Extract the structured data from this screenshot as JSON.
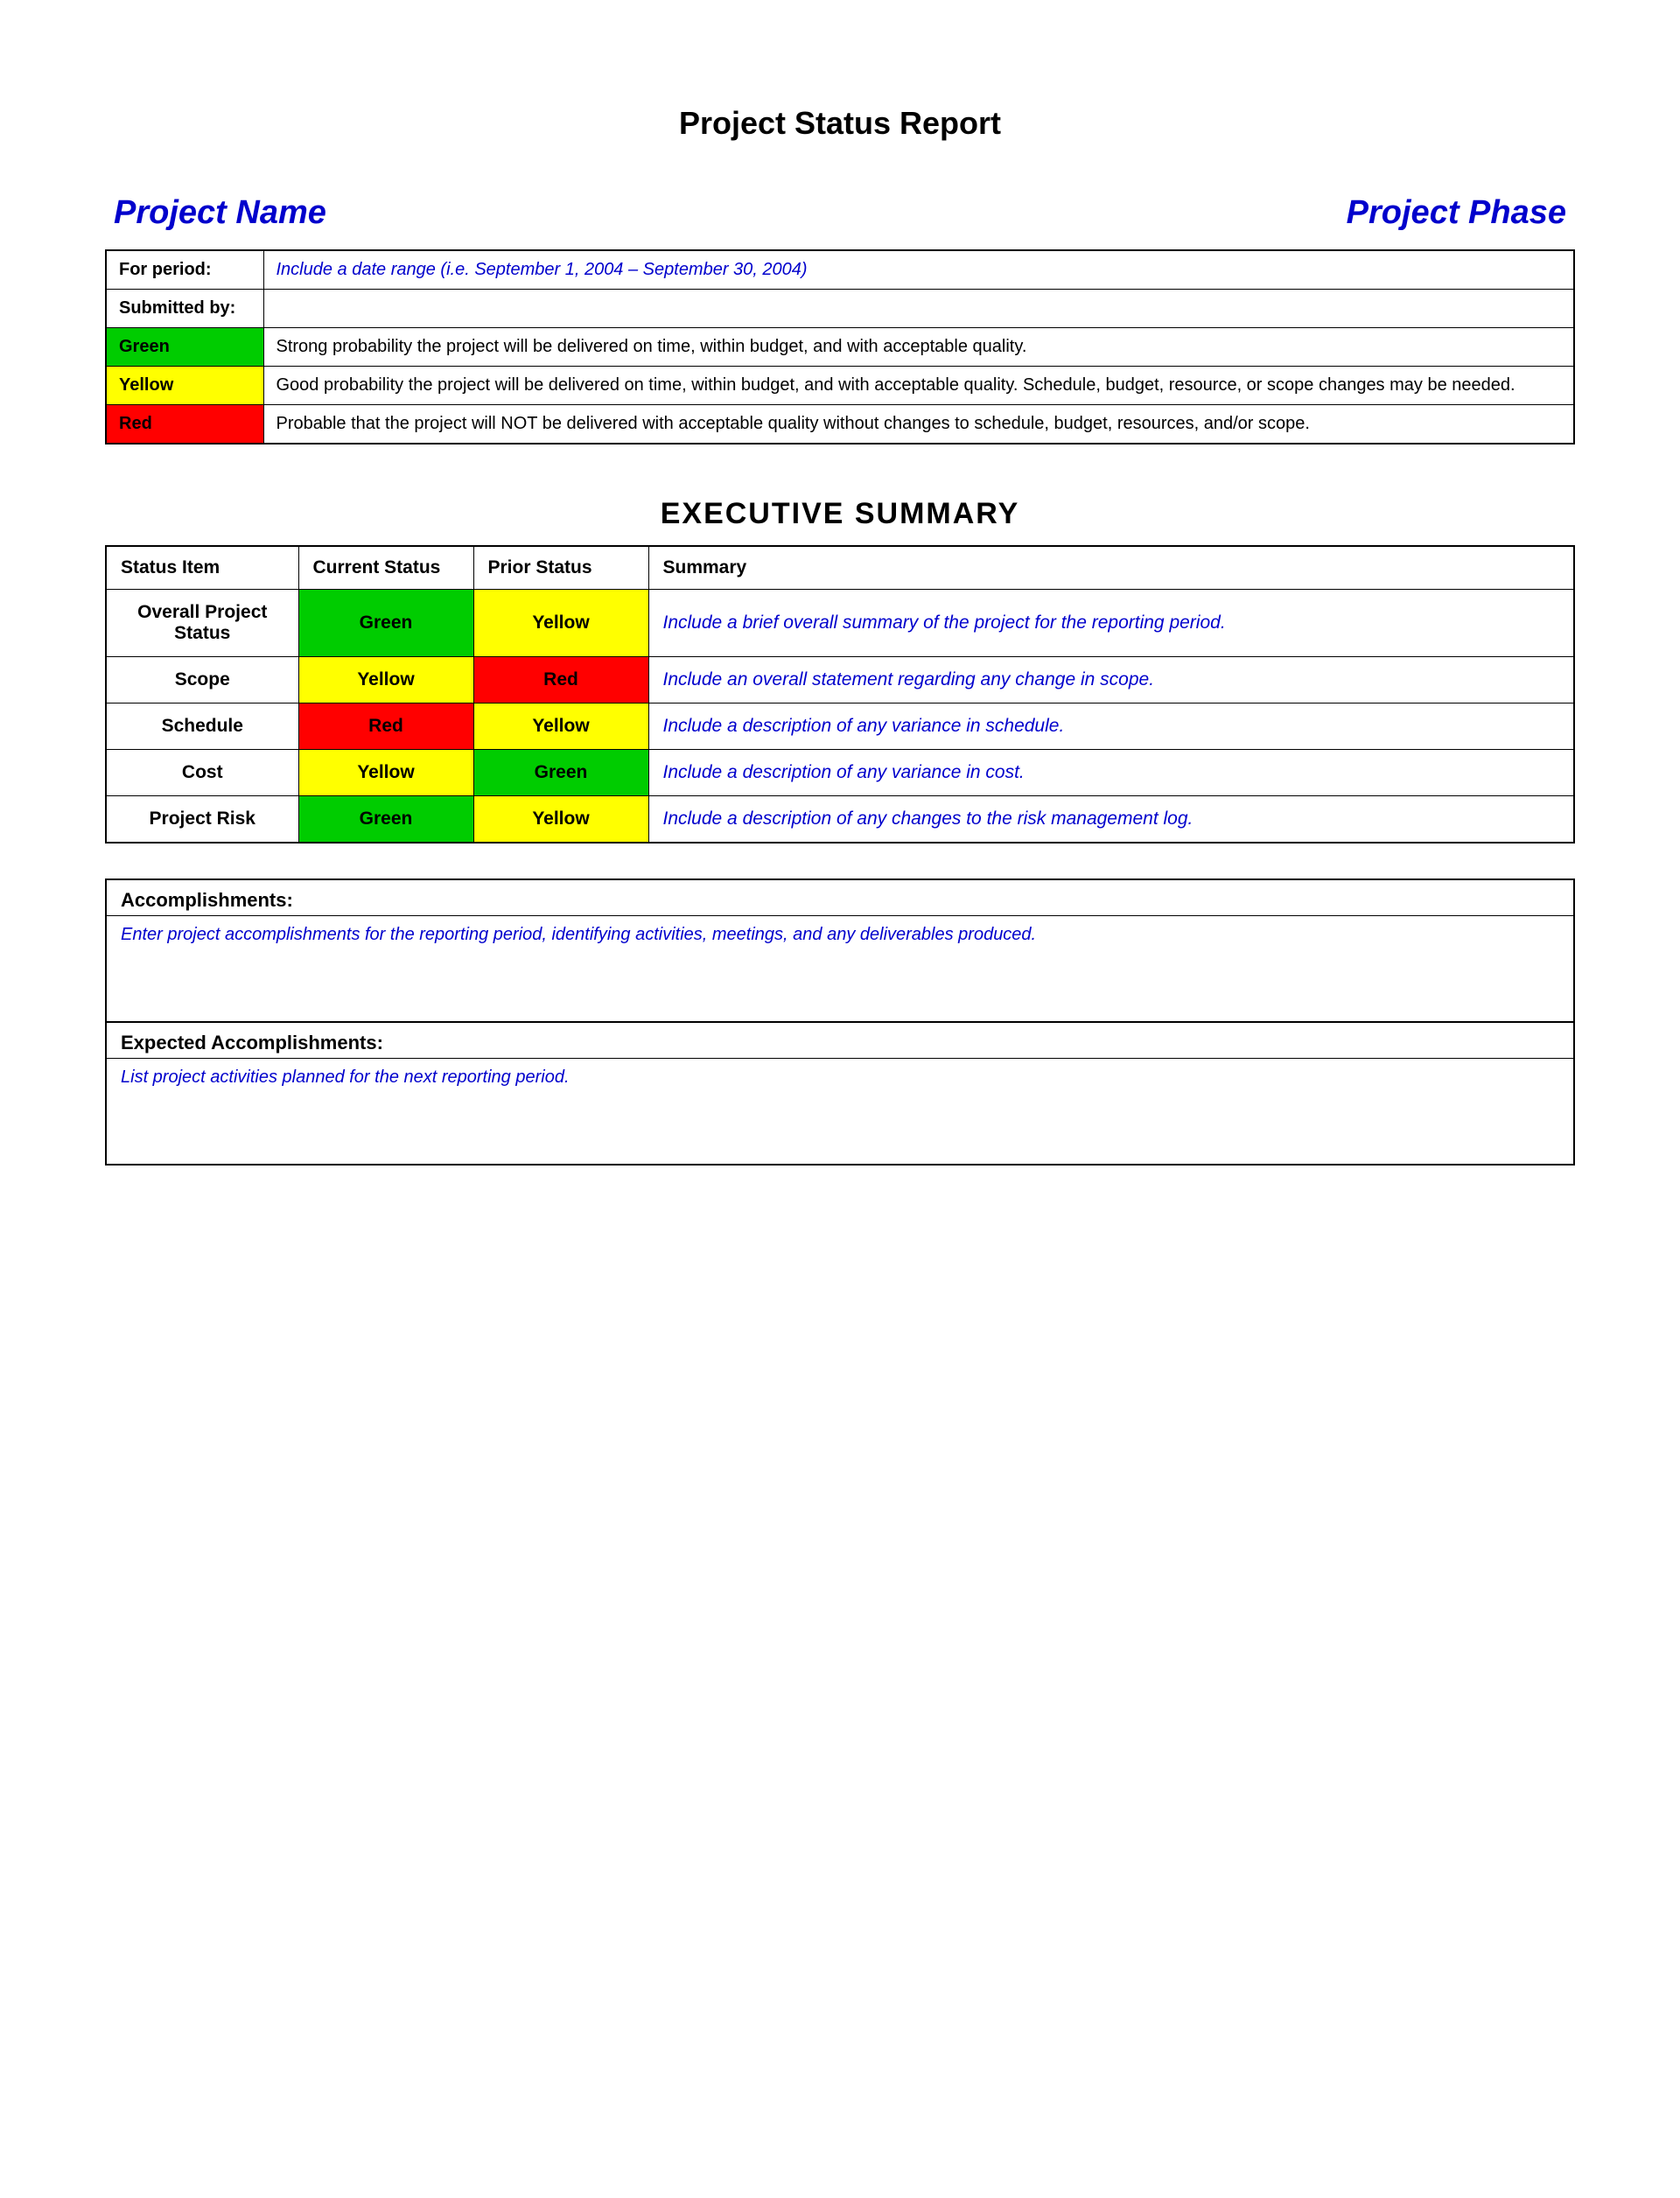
{
  "page": {
    "title": "Project Status Report",
    "project_name_label": "Project Name",
    "project_phase_label": "Project Phase"
  },
  "info_table": {
    "for_period_label": "For period:",
    "for_period_value": "Include a date range (i.e. September 1, 2004 – September 30, 2004)",
    "submitted_by_label": "Submitted by:",
    "submitted_by_value": "",
    "status_rows": [
      {
        "color": "Green",
        "description": "Strong probability the project will be delivered on time, within budget, and with acceptable quality."
      },
      {
        "color": "Yellow",
        "description": "Good probability the project will be delivered on time, within budget, and with acceptable quality. Schedule, budget, resource, or scope changes may be needed."
      },
      {
        "color": "Red",
        "description": "Probable that the project will NOT be delivered with acceptable quality without changes to schedule, budget, resources, and/or scope."
      }
    ]
  },
  "executive_summary": {
    "section_title": "EXECUTIVE SUMMARY",
    "columns": {
      "status_item": "Status Item",
      "current_status": "Current Status",
      "prior_status": "Prior Status",
      "summary": "Summary"
    },
    "rows": [
      {
        "item": "Overall Project Status",
        "current_status": "Green",
        "current_bg": "green",
        "prior_status": "Yellow",
        "prior_bg": "yellow",
        "summary": "Include a brief overall summary of the project for the reporting period."
      },
      {
        "item": "Scope",
        "current_status": "Yellow",
        "current_bg": "yellow",
        "prior_status": "Red",
        "prior_bg": "red",
        "summary": "Include an overall statement regarding any change in scope."
      },
      {
        "item": "Schedule",
        "current_status": "Red",
        "current_bg": "red",
        "prior_status": "Yellow",
        "prior_bg": "yellow",
        "summary": "Include a description of any variance in schedule."
      },
      {
        "item": "Cost",
        "current_status": "Yellow",
        "current_bg": "yellow",
        "prior_status": "Green",
        "prior_bg": "green",
        "summary": "Include a description of any variance in cost."
      },
      {
        "item": "Project Risk",
        "current_status": "Green",
        "current_bg": "green",
        "prior_status": "Yellow",
        "prior_bg": "yellow",
        "summary": "Include a description of any changes to the risk management log."
      }
    ],
    "accomplishments_label": "Accomplishments:",
    "accomplishments_content": "Enter project accomplishments for the reporting period, identifying activities, meetings, and any deliverables produced.",
    "expected_label": "Expected Accomplishments:",
    "expected_content": "List project activities planned for the next reporting period."
  }
}
